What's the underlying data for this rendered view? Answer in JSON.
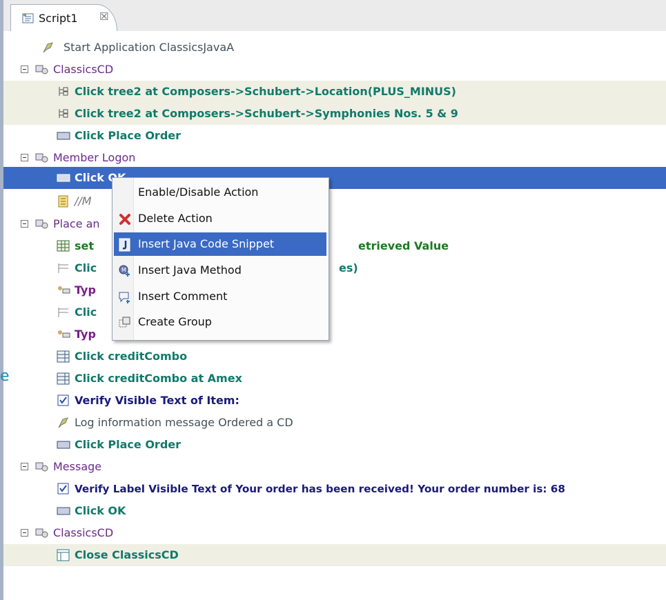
{
  "tab": {
    "label": "Script1",
    "close_symbol": "☒"
  },
  "stray_char": "e",
  "rows": [
    {
      "text": "Start Application ClassicsJavaA",
      "prefix": ""
    },
    {
      "text": "ClassicsCD"
    },
    {
      "text": "Click tree2 at Composers->Schubert->Location(PLUS_MINUS)"
    },
    {
      "text": "Click tree2 at Composers->Schubert->Symphonies Nos. 5 & 9"
    },
    {
      "text": "Click Place Order"
    },
    {
      "text": "Member Logon"
    },
    {
      "text": "Click OK"
    },
    {
      "text": "//M"
    },
    {
      "text": "Place an"
    },
    {
      "text": "set",
      "tail": "etrieved Value"
    },
    {
      "text": "Clic",
      "tail": "es)"
    },
    {
      "text": "Typ"
    },
    {
      "text": "Clic"
    },
    {
      "text": "Typ"
    },
    {
      "text": "Click creditCombo"
    },
    {
      "text": "Click creditCombo at Amex"
    },
    {
      "text": "Verify Visible Text of Item:"
    },
    {
      "text": "Log information message Ordered a CD"
    },
    {
      "text": "Click Place Order"
    },
    {
      "text": "Message"
    },
    {
      "text": "Verify Label Visible Text of Your order has been received! Your order number is: 68"
    },
    {
      "text": "Click OK"
    },
    {
      "text": "ClassicsCD"
    },
    {
      "text": "Close ClassicsCD"
    }
  ],
  "context_menu": {
    "items": [
      {
        "label": "Enable/Disable Action"
      },
      {
        "label": "Delete Action"
      },
      {
        "label": "Insert Java Code Snippet"
      },
      {
        "label": "Insert Java Method"
      },
      {
        "label": "Insert Comment"
      },
      {
        "label": "Create Group"
      }
    ]
  },
  "colors": {
    "selection": "#3a6ac4",
    "highlight_row": "#f0efe4",
    "action_text": "#117a6a",
    "group_text": "#6a2a8a"
  }
}
